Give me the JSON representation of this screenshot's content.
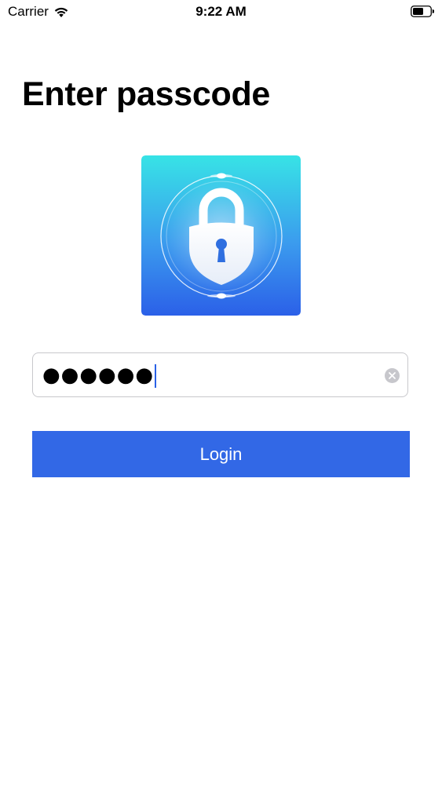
{
  "status_bar": {
    "carrier": "Carrier",
    "time": "9:22 AM",
    "icons": [
      "wifi-icon",
      "battery-icon"
    ]
  },
  "page": {
    "title": "Enter passcode"
  },
  "logo": {
    "icon": "lock-icon",
    "gradient_top": "#34e0e4",
    "gradient_bottom": "#2b62e8"
  },
  "passcode_field": {
    "value": "●●●●●●",
    "clear_icon": "clear-icon"
  },
  "login_button": {
    "label": "Login",
    "color": "#3268e6"
  }
}
